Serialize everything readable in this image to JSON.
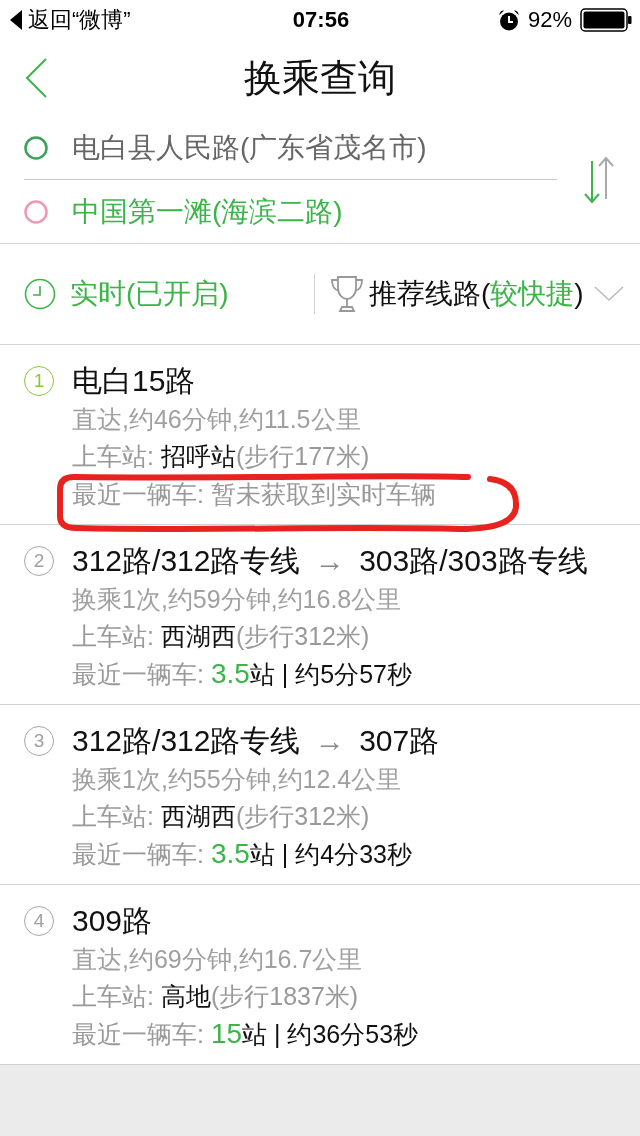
{
  "status_bar": {
    "back_label": "返回“微博”",
    "time": "07:56",
    "battery": "92%"
  },
  "nav": {
    "title": "换乘查询"
  },
  "places": [
    {
      "kind": "origin",
      "name": "电白县人民路(广东省茂名市)",
      "color": "#3aa35a"
    },
    {
      "kind": "destination",
      "name": "中国第一滩(海滨二路)",
      "color": "#ef98b3"
    }
  ],
  "realtime": {
    "label": "实时(已开启)",
    "on": true
  },
  "sort": {
    "parts": [
      {
        "text": "推荐线路(",
        "accent": false
      },
      {
        "text": "较快捷",
        "accent": true
      },
      {
        "text": ")",
        "accent": false
      }
    ]
  },
  "routes": [
    {
      "number": "1",
      "selected": true,
      "title_parts": [
        {
          "kind": "line",
          "text": "电白15路"
        }
      ],
      "summary": "直达,约46分钟,约11.5公里",
      "boarding": {
        "label": "上车站:",
        "station": "招呼站",
        "walk": "(步行177米)"
      },
      "next_bus": {
        "label": "最近一辆车:",
        "parts": [
          {
            "kind": "status",
            "text": "暂未获取到实时车辆"
          }
        ]
      }
    },
    {
      "number": "2",
      "selected": false,
      "title_parts": [
        {
          "kind": "line",
          "text": "312路/312路专线"
        },
        {
          "kind": "arrow",
          "text": "→"
        },
        {
          "kind": "line",
          "text": "303路/303路专线"
        }
      ],
      "summary": "换乘1次,约59分钟,约16.8公里",
      "boarding": {
        "label": "上车站:",
        "station": "西湖西",
        "walk": "(步行312米)"
      },
      "next_bus": {
        "label": "最近一辆车:",
        "parts": [
          {
            "kind": "count",
            "text": "3.5"
          },
          {
            "kind": "detail",
            "text": "站 | 约5分57秒"
          }
        ]
      }
    },
    {
      "number": "3",
      "selected": false,
      "title_parts": [
        {
          "kind": "line",
          "text": "312路/312路专线"
        },
        {
          "kind": "arrow",
          "text": "→"
        },
        {
          "kind": "line",
          "text": "307路"
        }
      ],
      "summary": "换乘1次,约55分钟,约12.4公里",
      "boarding": {
        "label": "上车站:",
        "station": "西湖西",
        "walk": "(步行312米)"
      },
      "next_bus": {
        "label": "最近一辆车:",
        "parts": [
          {
            "kind": "count",
            "text": "3.5"
          },
          {
            "kind": "detail",
            "text": "站 | 约4分33秒"
          }
        ]
      }
    },
    {
      "number": "4",
      "selected": false,
      "title_parts": [
        {
          "kind": "line",
          "text": "309路"
        }
      ],
      "summary": "直达,约69分钟,约16.7公里",
      "boarding": {
        "label": "上车站:",
        "station": "高地",
        "walk": "(步行1837米)"
      },
      "next_bus": {
        "label": "最近一辆车:",
        "parts": [
          {
            "kind": "count",
            "text": "15"
          },
          {
            "kind": "detail",
            "text": "站 | 约36分53秒"
          }
        ]
      }
    }
  ],
  "annotation": {
    "kind": "freehand_circle"
  }
}
